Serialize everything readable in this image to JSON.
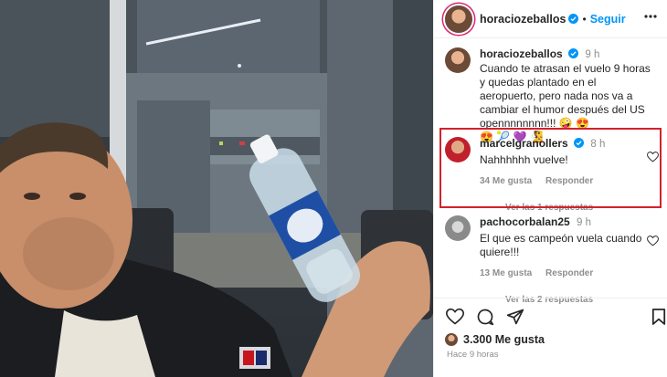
{
  "header": {
    "username": "horaciozeballos",
    "separator": "•",
    "follow_label": "Seguir"
  },
  "caption": {
    "username": "horaciozeballos",
    "time": "9 h",
    "text": "Cuando te atrasan el vuelo 9 horas y quedas plantado en el aeropuerto, pero nada nos va a cambiar el humor después del US opennnnnnnn!!! 🤪 😍",
    "emojis": "😍 🎾 💜 🧏"
  },
  "comments": [
    {
      "username": "marcelgranollers",
      "verified": true,
      "time": "8 h",
      "text": "Nahhhhhh vuelve!",
      "likes": "34 Me gusta",
      "reply_label": "Responder",
      "replies": "Ver las 1 respuestas"
    },
    {
      "username": "pachocorbalan25",
      "verified": false,
      "time": "9 h",
      "text": "El que es campeón vuela cuando quiere!!!",
      "likes": "13 Me gusta",
      "reply_label": "Responder",
      "replies": "Ver las 2 respuestas"
    }
  ],
  "footer": {
    "likes_count": "3.300 Me gusta",
    "posted_ago": "Hace 9 horas"
  },
  "icons": [
    "heart-icon",
    "comment-icon",
    "share-icon",
    "bookmark-icon",
    "verified-badge-icon",
    "more-options-icon"
  ],
  "colors": {
    "follow": "#0095f6",
    "highlight": "#d3212c",
    "verified": "#0095f6"
  }
}
